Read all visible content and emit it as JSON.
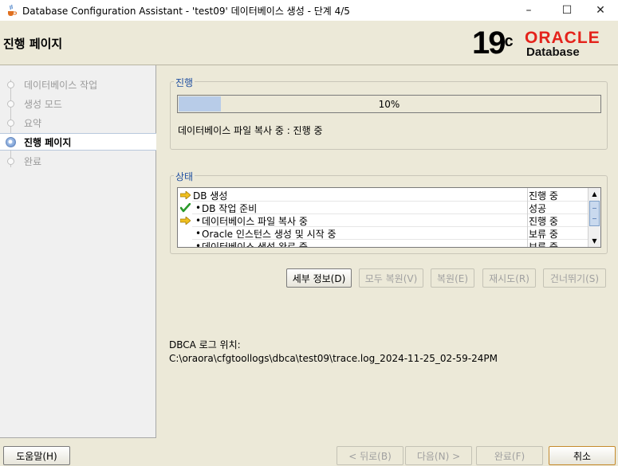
{
  "window": {
    "title": "Database Configuration Assistant - 'test09' 데이터베이스 생성 - 단계 4/5",
    "minimize": "–",
    "maximize": "☐",
    "close": "✕",
    "icon": "java-cup-icon"
  },
  "header": {
    "page_title": "진행 페이지",
    "logo": {
      "version": "19",
      "version_suffix": "c",
      "brand": "ORACLE",
      "product": "Database"
    }
  },
  "nav": {
    "items": [
      {
        "label": "데이터베이스 작업",
        "state": "done"
      },
      {
        "label": "생성 모드",
        "state": "done"
      },
      {
        "label": "요약",
        "state": "done"
      },
      {
        "label": "진행 페이지",
        "state": "active"
      },
      {
        "label": "완료",
        "state": "pending"
      }
    ]
  },
  "progress": {
    "legend": "진행",
    "percent_label": "10%",
    "percent_value": 10,
    "status_text": "데이터베이스 파일 복사 중 : 진행 중"
  },
  "status": {
    "legend": "상태",
    "rows": [
      {
        "icon": "arrow-right-icon",
        "name": "DB 생성",
        "state": "진행 중",
        "indent": false
      },
      {
        "icon": "checkmark-icon",
        "name": "DB 작업 준비",
        "state": "성공",
        "indent": true
      },
      {
        "icon": "arrow-right-icon",
        "name": "데이터베이스 파일 복사 중",
        "state": "진행 중",
        "indent": true
      },
      {
        "icon": "",
        "name": "Oracle 인스턴스 생성 및 시작 중",
        "state": "보류 중",
        "indent": true
      },
      {
        "icon": "",
        "name": "데이터베이스 생성 완료 중",
        "state": "보류 중",
        "indent": true
      }
    ],
    "bullet": "•"
  },
  "actions": {
    "details": "세부 정보(D)",
    "revert_all": "모두 복원(V)",
    "revert": "복원(E)",
    "retry": "재시도(R)",
    "skip": "건너뛰기(S)"
  },
  "log": {
    "label": "DBCA 로그 위치:",
    "path": "C:\\oraora\\cfgtoollogs\\dbca\\test09\\trace.log_2024-11-25_02-59-24PM"
  },
  "footer": {
    "help": "도움말(H)",
    "back": "< 뒤로(B)",
    "next": "다음(N) >",
    "finish": "완료(F)",
    "cancel": "취소"
  },
  "colors": {
    "accent": "#1f4fa0",
    "progress_fill": "#b8cce8",
    "oracle_red": "#e4231b"
  }
}
